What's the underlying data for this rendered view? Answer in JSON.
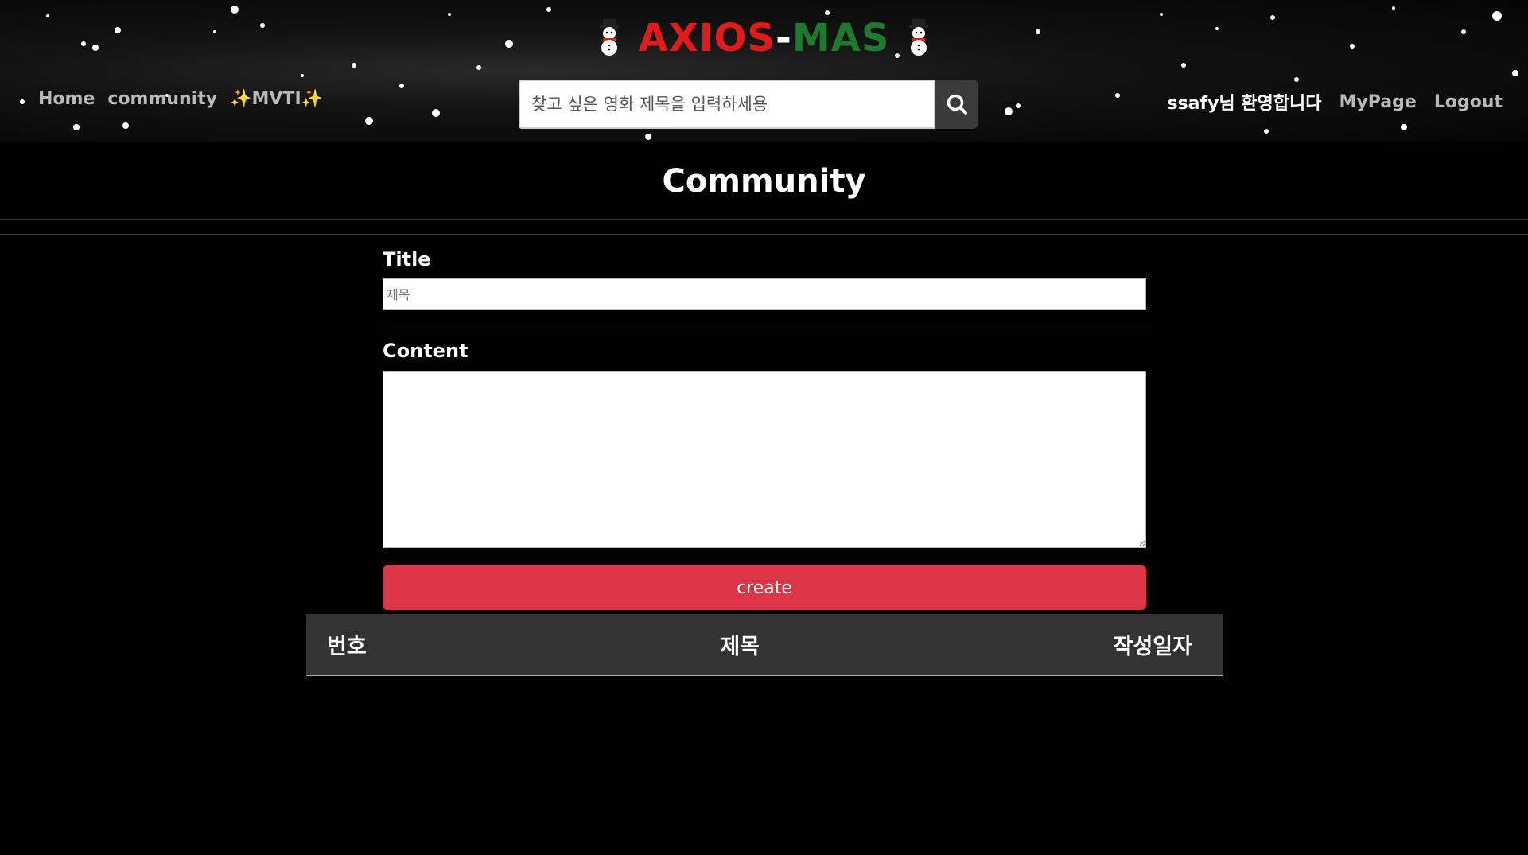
{
  "header": {
    "logo_part1": "AXIOS",
    "logo_dash": "-",
    "logo_part2": "MAS",
    "nav": {
      "home": "Home",
      "community": "community",
      "mvti_sparkle": "✨",
      "mvti": "MVTI"
    },
    "search": {
      "placeholder": "찾고 싶은 영화 제목을 입력하세용"
    },
    "user": {
      "welcome": "ssafy님 환영합니다",
      "mypage": "MyPage",
      "logout": "Logout"
    }
  },
  "page": {
    "title": "Community"
  },
  "form": {
    "title_label": "Title",
    "title_placeholder": "제목",
    "content_label": "Content",
    "submit_label": "create"
  },
  "table": {
    "columns": [
      "번호",
      "제목",
      "작성일자"
    ]
  },
  "colors": {
    "logo_red": "#e41a1a",
    "logo_green": "#1e7a2e",
    "create_button": "#dc3545",
    "table_header_bg": "#333333"
  }
}
